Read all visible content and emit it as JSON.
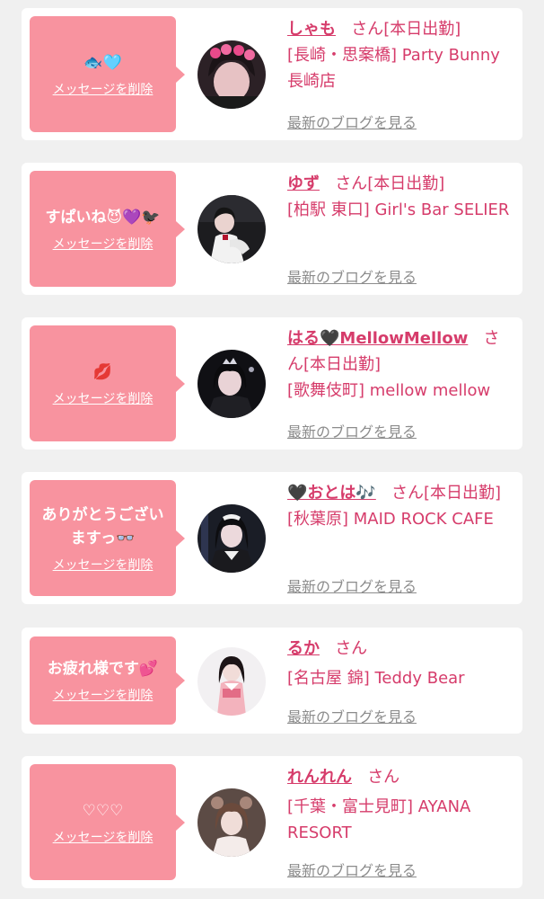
{
  "delete_label": "メッセージを削除",
  "blog_label": "最新のブログを見る",
  "san_suffix": "さん",
  "colors": {
    "bubble": "#f8939f",
    "name": "#d63c6b",
    "link_gray": "#8c8c8c",
    "card": "#ffffff",
    "background": "#f0f0f0"
  },
  "items": [
    {
      "message": "🐟🩵",
      "name": "しゃも",
      "status": "[本日出勤]",
      "shop": "[長崎・思案橋] Party Bunny 長崎店"
    },
    {
      "message": "すぱいね😈💜🐦‍⬛",
      "name": "ゆず",
      "status": "[本日出勤]",
      "shop": "[柏駅 東口] Girl's Bar SELIER"
    },
    {
      "message": "💋",
      "name": "はる🖤MellowMellow",
      "status": "[本日出勤]",
      "shop": "[歌舞伎町] mellow mellow"
    },
    {
      "message": "ありがとうございますっ👓",
      "name": "🖤おとは🎶",
      "status": "[本日出勤]",
      "shop": "[秋葉原] MAID ROCK CAFE"
    },
    {
      "message": "お疲れ様です💕",
      "name": "るか",
      "status": "",
      "shop": "[名古屋 錦] Teddy Bear"
    },
    {
      "message": "♡♡♡",
      "name": "れんれん",
      "status": "",
      "shop": "[千葉・富士見町] AYANA RESORT"
    }
  ]
}
